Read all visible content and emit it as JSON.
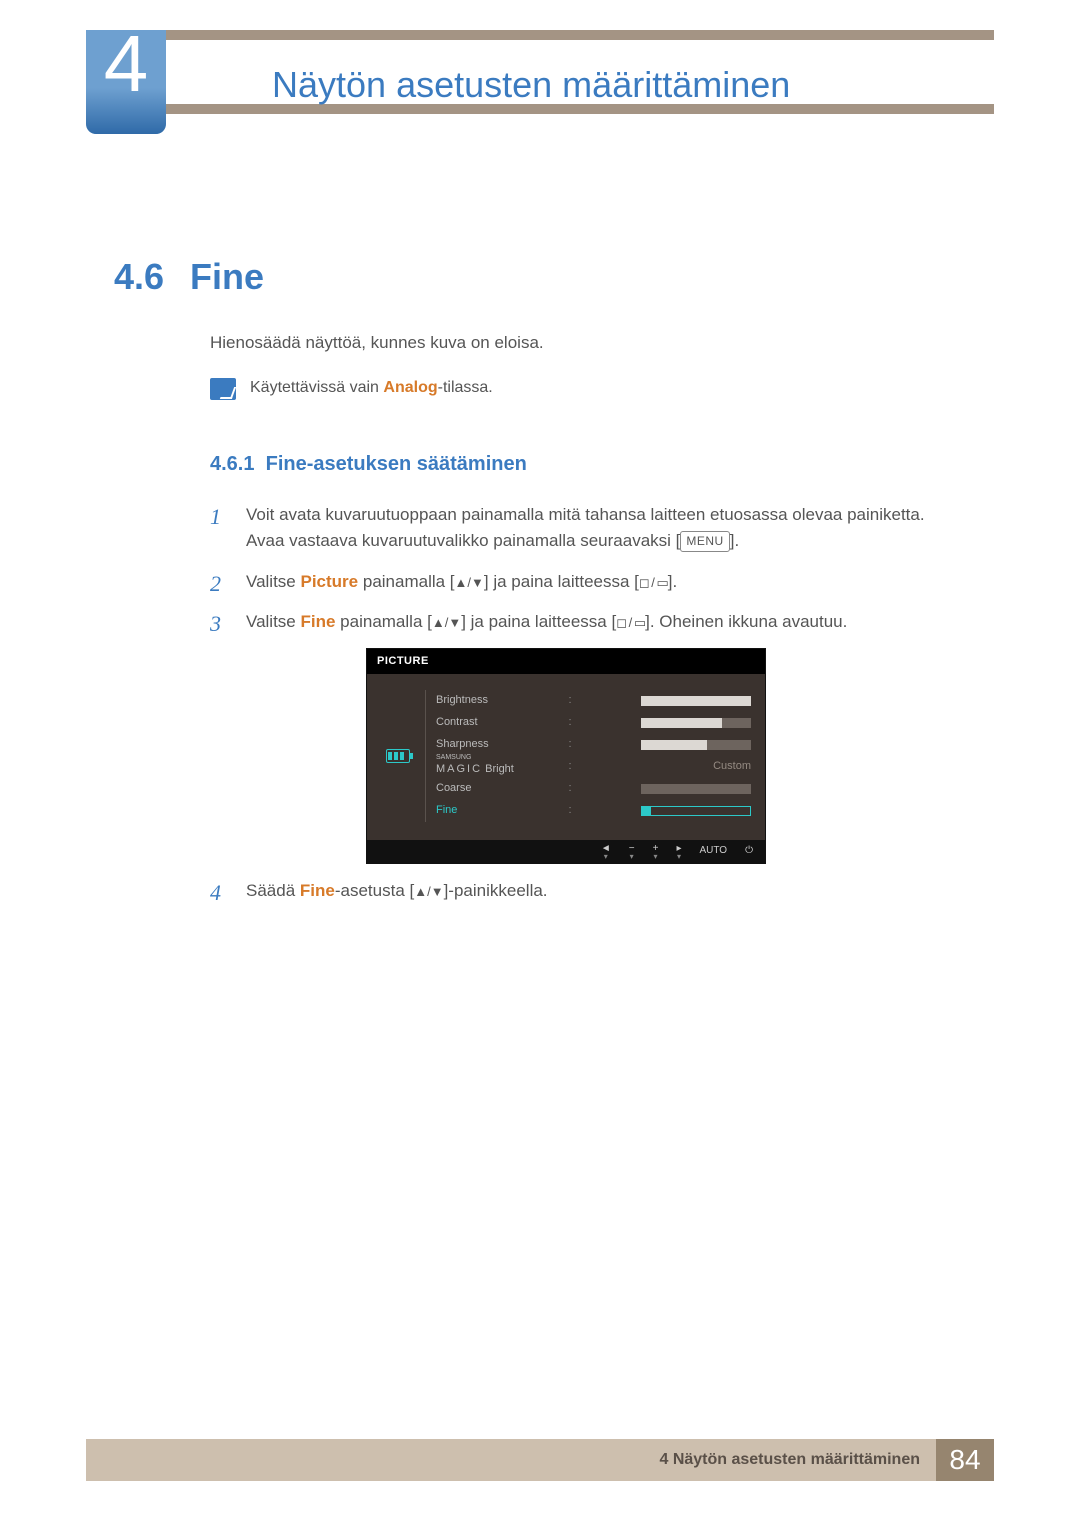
{
  "chapter": {
    "number": "4",
    "title": "Näytön asetusten määrittäminen"
  },
  "section": {
    "number": "4.6",
    "title": "Fine"
  },
  "intro": "Hienosäädä näyttöä, kunnes kuva on eloisa.",
  "note": {
    "pre": "Käytettävissä vain ",
    "hl": "Analog",
    "post": "-tilassa."
  },
  "subsection": {
    "number": "4.6.1",
    "title": "Fine-asetuksen säätäminen"
  },
  "steps": {
    "s1": {
      "num": "1",
      "text_a": "Voit avata kuvaruutuoppaan painamalla mitä tahansa laitteen etuosassa olevaa painiketta. Avaa vastaava kuvaruutuvalikko painamalla seuraavaksi [",
      "menu": "MENU",
      "text_b": "]."
    },
    "s2": {
      "num": "2",
      "pre": "Valitse ",
      "hl": "Picture",
      "mid1": " painamalla [",
      "arrows": "▲/▼",
      "mid2": "] ja paina laitteessa [",
      "pair": "◻ / ▭",
      "post": "]."
    },
    "s3": {
      "num": "3",
      "pre": "Valitse ",
      "hl": "Fine",
      "mid1": " painamalla [",
      "arrows": "▲/▼",
      "mid2": "] ja paina laitteessa [",
      "pair": "◻ / ▭",
      "post": "]. Oheinen ikkuna avautuu."
    },
    "s4": {
      "num": "4",
      "pre": "Säädä ",
      "hl": "Fine",
      "mid1": "-asetusta [",
      "arrows": "▲/▼",
      "post": "]-painikkeella."
    }
  },
  "osd": {
    "title": "PICTURE",
    "rows": {
      "brightness": {
        "label": "Brightness",
        "fill": 100
      },
      "contrast": {
        "label": "Contrast",
        "fill": 74
      },
      "sharpness": {
        "label": "Sharpness",
        "fill": 60
      },
      "magic": {
        "label_top": "SAMSUNG",
        "label_bottom": "MAGIC",
        "label_suffix": " Bright",
        "value": "Custom"
      },
      "coarse": {
        "label": "Coarse",
        "fill": 0
      },
      "fine": {
        "label": "Fine",
        "fill": 8
      }
    },
    "footer": {
      "auto": "AUTO"
    }
  },
  "footer": {
    "text": "4 Näytön asetusten määrittäminen",
    "page": "84"
  }
}
